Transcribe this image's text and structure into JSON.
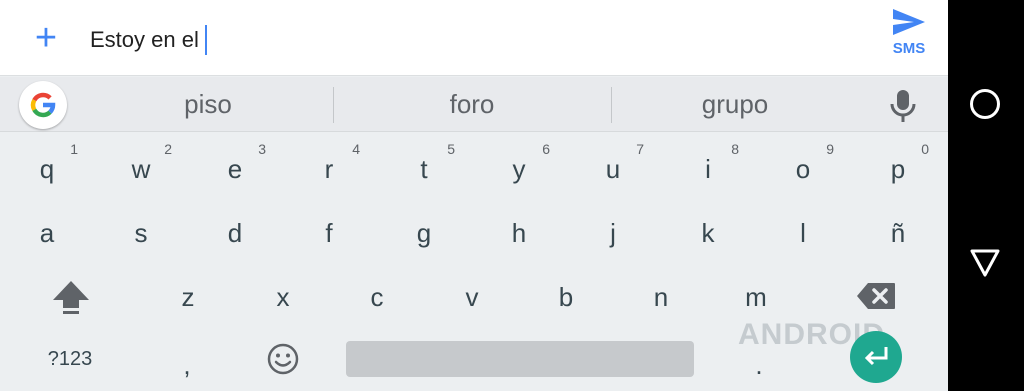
{
  "compose": {
    "plus_icon": "plus-icon",
    "message_text": "Estoy en el",
    "send_icon": "send-icon",
    "send_label": "SMS",
    "accent_color": "#4285f4"
  },
  "suggestions": {
    "google_icon": "google-g-icon",
    "words": [
      "piso",
      "foro",
      "grupo"
    ],
    "mic_icon": "microphone-icon"
  },
  "keyboard": {
    "row1": [
      {
        "key": "q",
        "hint": "1"
      },
      {
        "key": "w",
        "hint": "2"
      },
      {
        "key": "e",
        "hint": "3"
      },
      {
        "key": "r",
        "hint": "4"
      },
      {
        "key": "t",
        "hint": "5"
      },
      {
        "key": "y",
        "hint": "6"
      },
      {
        "key": "u",
        "hint": "7"
      },
      {
        "key": "i",
        "hint": "8"
      },
      {
        "key": "o",
        "hint": "9"
      },
      {
        "key": "p",
        "hint": "0"
      }
    ],
    "row2": [
      "a",
      "s",
      "d",
      "f",
      "g",
      "h",
      "j",
      "k",
      "l",
      "ñ"
    ],
    "row3": [
      "z",
      "x",
      "c",
      "v",
      "b",
      "n",
      "m"
    ],
    "shift_icon": "shift-arrow-icon",
    "backspace_icon": "backspace-icon",
    "symbols_label": "?123",
    "comma_label": ",",
    "emoji_icon": "emoji-icon",
    "period_label": ".",
    "enter_icon": "enter-icon",
    "enter_color": "#1fa890"
  },
  "watermark": {
    "text": "ANDROID"
  },
  "navbar": {
    "home_icon": "home-circle-icon",
    "back_icon": "back-triangle-icon"
  }
}
